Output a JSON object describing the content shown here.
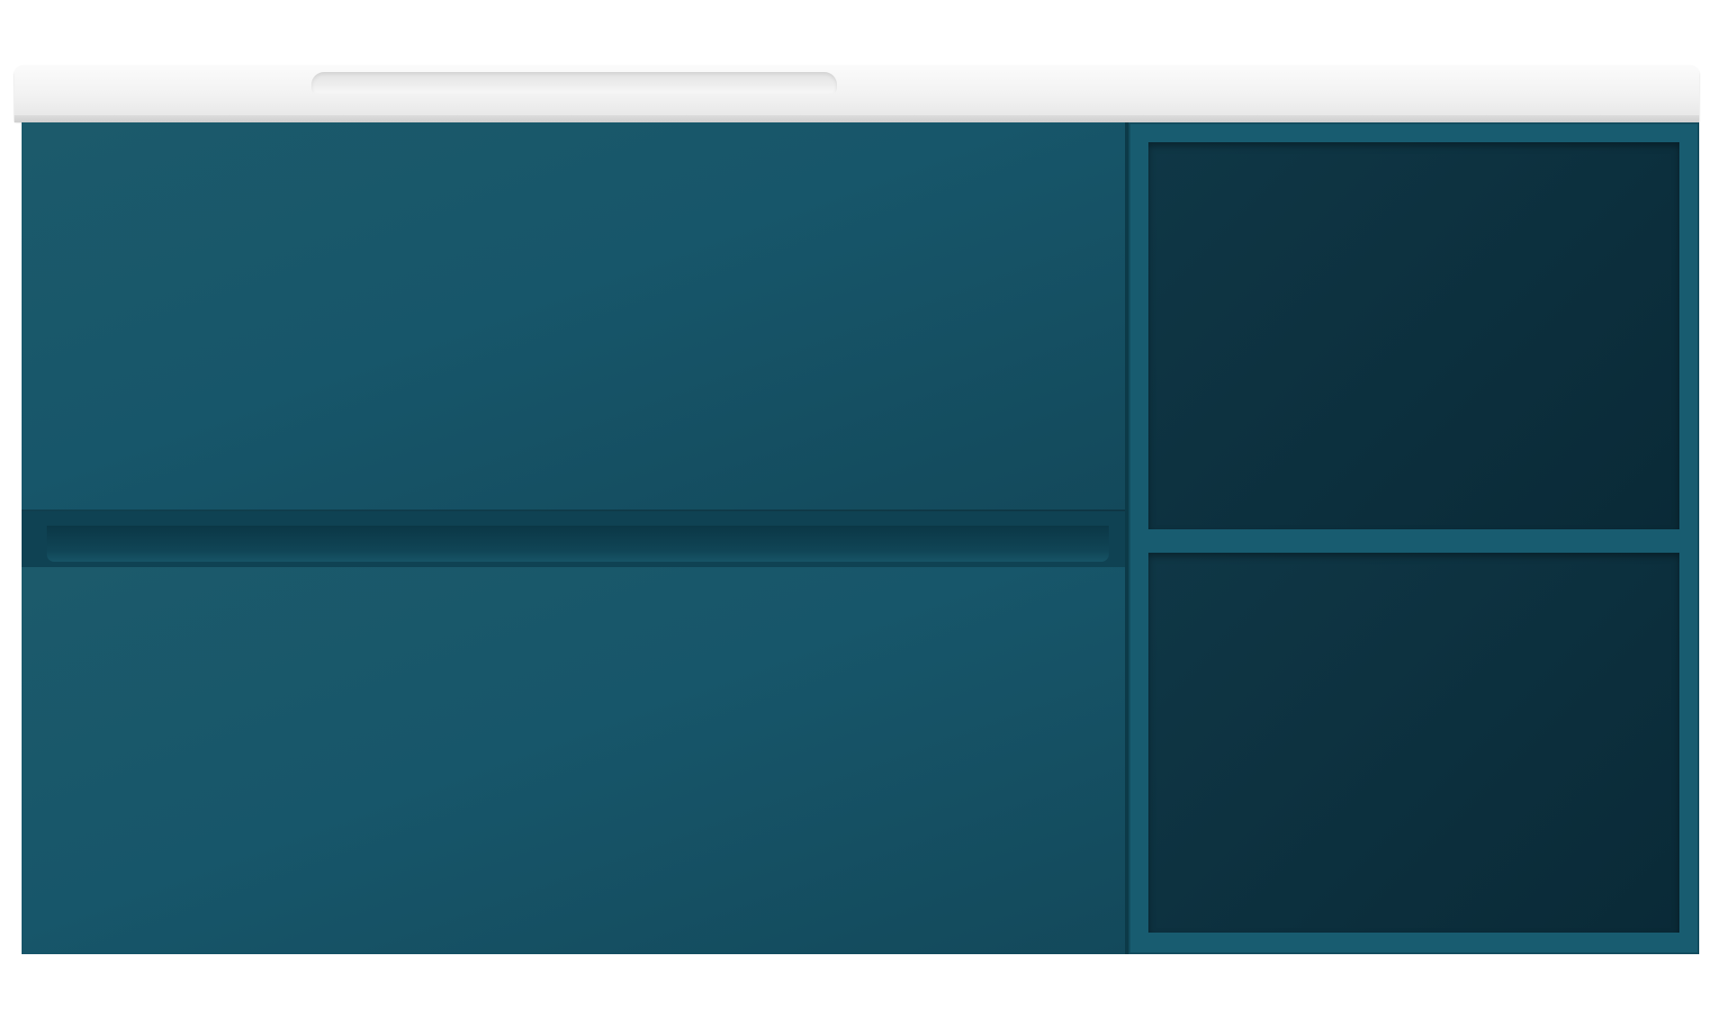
{
  "scene": {
    "type": "product-photo",
    "colors": {
      "cabinet": "#17566a",
      "cabinet_dark": "#0f4253",
      "niche": "#0c2f3d",
      "countertop": "#f2f2f2",
      "background": "#ffffff"
    },
    "drawers": 2,
    "open_shelves": 2
  }
}
